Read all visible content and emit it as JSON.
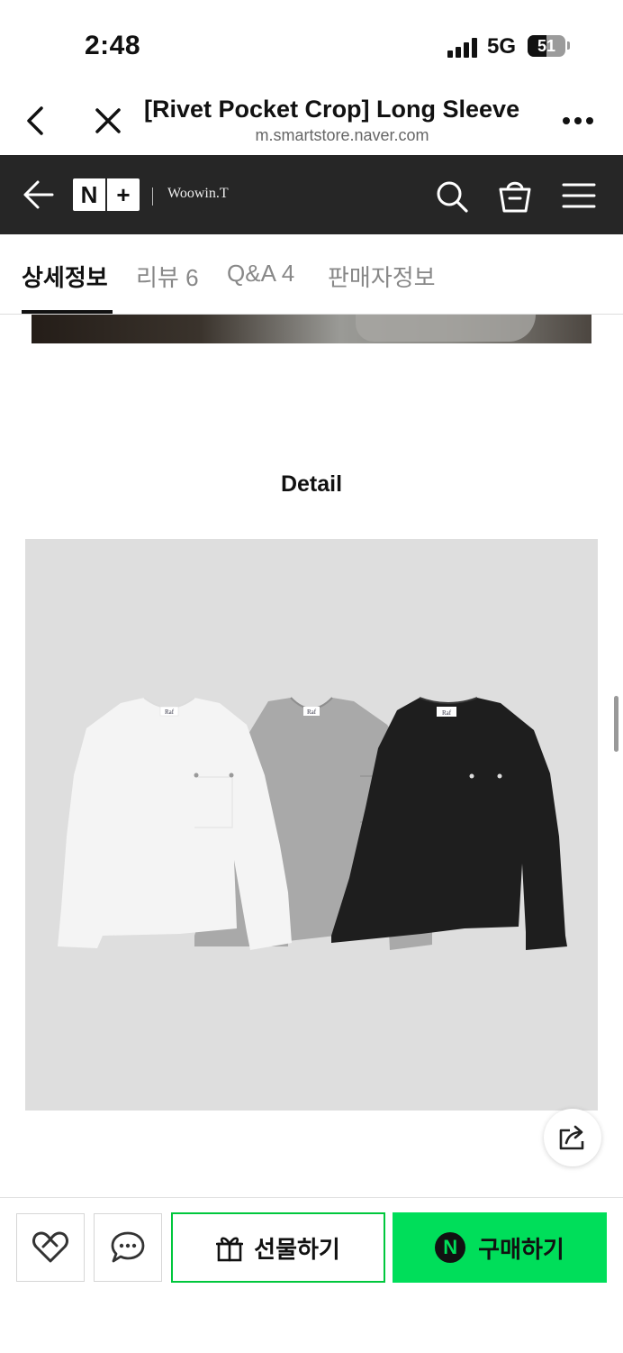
{
  "status_bar": {
    "time": "2:48",
    "network": "5G",
    "battery": "51",
    "battery_level": 0.51
  },
  "browser": {
    "title": "[Rivet Pocket Crop] Long Sleeve",
    "url": "m.smartstore.naver.com"
  },
  "store": {
    "logo_left": "N",
    "logo_right": "+",
    "name": "Woowin.T"
  },
  "tabs": [
    {
      "label": "상세정보",
      "active": true
    },
    {
      "label": "리뷰 6",
      "active": false
    },
    {
      "label": "Q&A 4",
      "active": false
    },
    {
      "label": "판매자정보",
      "active": false
    }
  ],
  "content": {
    "detail_heading": "Detail",
    "product_shirts": [
      {
        "color": "white",
        "hex": "#f4f4f4",
        "tag": "Raf"
      },
      {
        "color": "gray",
        "hex": "#a9a9a9",
        "tag": "Raf"
      },
      {
        "color": "black",
        "hex": "#1e1e1e",
        "tag": "Raf"
      }
    ]
  },
  "bottom_bar": {
    "gift_label": "선물하기",
    "buy_label": "구매하기",
    "buy_badge": "N",
    "accent_color": "#00de5a"
  }
}
